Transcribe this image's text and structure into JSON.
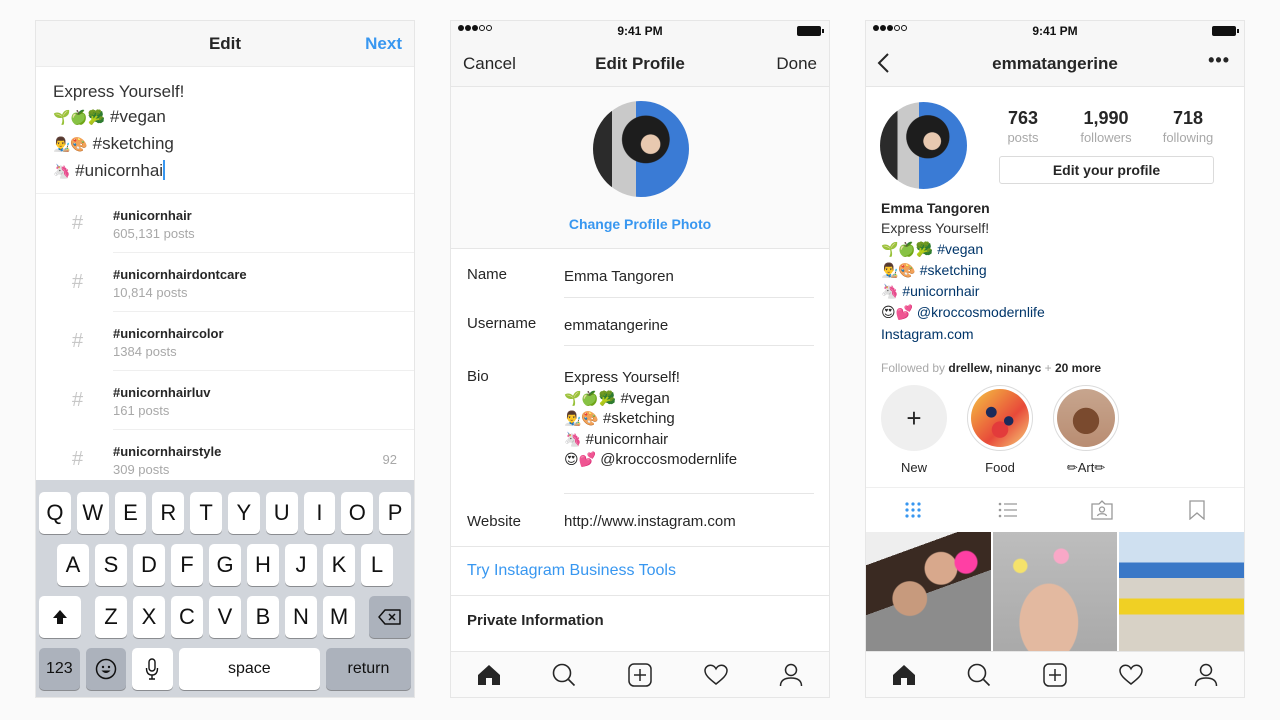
{
  "screen_compose": {
    "nav": {
      "title": "Edit",
      "next_label": "Next"
    },
    "text_lines": [
      {
        "emoji": "",
        "text": "Express Yourself!"
      },
      {
        "emoji": "🌱🍏🥦",
        "text": "#vegan"
      },
      {
        "emoji": "👨‍🎨🎨",
        "text": "#sketching"
      },
      {
        "emoji": "🦄",
        "text": "#unicornhai"
      }
    ],
    "hashtag_suggestions": [
      {
        "tag": "#unicornhair",
        "count": "605,131 posts",
        "badge": ""
      },
      {
        "tag": "#unicornhairdontcare",
        "count": "10,814 posts",
        "badge": ""
      },
      {
        "tag": "#unicornhaircolor",
        "count": "1384 posts",
        "badge": ""
      },
      {
        "tag": "#unicornhairluv",
        "count": "161 posts",
        "badge": ""
      },
      {
        "tag": "#unicornhairstyle",
        "count": "309 posts",
        "badge": "92"
      }
    ],
    "hash_symbol": "#",
    "keyboard": {
      "row1": [
        "Q",
        "W",
        "E",
        "R",
        "T",
        "Y",
        "U",
        "I",
        "O",
        "P"
      ],
      "row2": [
        "A",
        "S",
        "D",
        "F",
        "G",
        "H",
        "J",
        "K",
        "L"
      ],
      "row3": [
        "Z",
        "X",
        "C",
        "V",
        "B",
        "N",
        "M"
      ],
      "shift_icon": "shift-arrow-icon",
      "delete_icon": "backspace-icon",
      "numbers_label": "123",
      "emoji_icon": "emoji-icon",
      "mic_icon": "microphone-icon",
      "space_label": "space",
      "return_label": "return"
    }
  },
  "status_bar": {
    "time": "9:41 PM",
    "signal_bars": 3,
    "signal_total": 5
  },
  "screen_edit_profile": {
    "nav": {
      "cancel_label": "Cancel",
      "title": "Edit Profile",
      "done_label": "Done"
    },
    "change_photo_label": "Change Profile Photo",
    "fields": {
      "name": {
        "label": "Name",
        "value": "Emma Tangoren"
      },
      "username": {
        "label": "Username",
        "value": "emmatangerine"
      },
      "bio": {
        "label": "Bio",
        "lines": [
          {
            "emoji": "",
            "text": "Express Yourself!"
          },
          {
            "emoji": "🌱🍏🥦",
            "text": "#vegan"
          },
          {
            "emoji": "👨‍🎨🎨",
            "text": "#sketching"
          },
          {
            "emoji": "🦄",
            "text": "#unicornhair"
          },
          {
            "emoji": "😍💕",
            "text": "@kroccosmodernlife"
          }
        ]
      },
      "website": {
        "label": "Website",
        "value": "http://www.instagram.com"
      }
    },
    "business_tools_label": "Try Instagram Business Tools",
    "private_info_label": "Private Information"
  },
  "tab_bar": [
    "home-icon",
    "search-icon",
    "add-post-icon",
    "heart-icon",
    "profile-icon"
  ],
  "screen_profile": {
    "nav": {
      "username": "emmatangerine",
      "back_icon": "chevron-left-icon",
      "more_icon": "more-dots-icon",
      "more_label": "•••"
    },
    "stats": [
      {
        "value": "763",
        "label": "posts"
      },
      {
        "value": "1,990",
        "label": "followers"
      },
      {
        "value": "718",
        "label": "following"
      }
    ],
    "edit_button_label": "Edit your profile",
    "full_name": "Emma Tangoren",
    "bio_intro": "Express Yourself!",
    "bio_lines": [
      {
        "emoji": "🌱🍏🥦",
        "text": "#vegan"
      },
      {
        "emoji": "👨‍🎨🎨",
        "text": "#sketching"
      },
      {
        "emoji": "🦄",
        "text": "#unicornhair"
      },
      {
        "emoji": "😍💕",
        "text": "@kroccosmodernlife"
      }
    ],
    "website": "Instagram.com",
    "followed_by": {
      "prefix": "Followed by",
      "names": "drellew, ninanyc",
      "plus": "+",
      "more": "20 more"
    },
    "highlights": [
      {
        "label": "New",
        "icon": "+"
      },
      {
        "label": "Food",
        "icon": ""
      },
      {
        "label": "✏Art✏",
        "icon": ""
      }
    ],
    "profile_tabs": [
      "grid-icon",
      "list-icon",
      "tagged-icon",
      "saved-bookmark-icon"
    ],
    "accent_color": "#3897f0",
    "link_color": "#003569"
  }
}
